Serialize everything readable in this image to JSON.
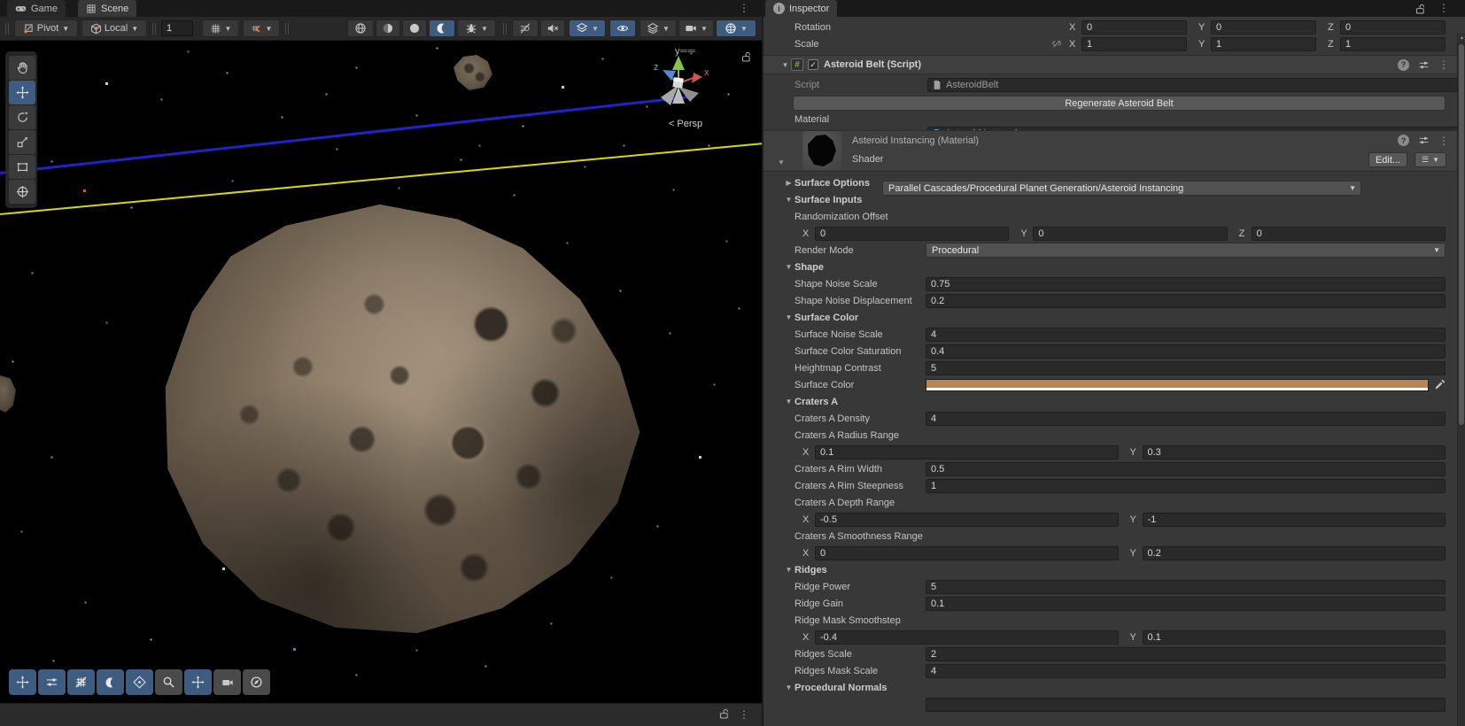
{
  "scene": {
    "tabs": [
      {
        "label": "Game"
      },
      {
        "label": "Scene"
      }
    ],
    "toolbar": {
      "pivot_label": "Pivot",
      "orientation_label": "Local",
      "grid_size": "1",
      "toggle_icons": [
        "wire-sphere-icon",
        "half-sphere-icon",
        "solid-sphere-icon",
        "crescent-icon",
        "bug-icon",
        "2d-off-icon",
        "speaker-muted-icon",
        "layers-paint-icon",
        "eye-icon",
        "layers-icon",
        "camera-icon",
        "gizmo-sphere-icon"
      ]
    },
    "overlays": {
      "tools": [
        "hand-tool",
        "move-tool",
        "rotate-tool",
        "scale-tool",
        "rect-tool",
        "transform-tool"
      ],
      "active_tool": "move-tool",
      "bottom_buttons": [
        "tools",
        "tool-settings",
        "grid-snap",
        "view-options",
        "gizmos",
        "search",
        "orientation",
        "camera-preview",
        "navigation"
      ]
    },
    "viewport": {
      "persp_label": "< Persp",
      "axis_x": "x",
      "axis_y": "y",
      "axis_z": "z"
    }
  },
  "inspector": {
    "tab_label": "Inspector",
    "transform": {
      "rotation_label": "Rotation",
      "rotation": {
        "x": "0",
        "y": "0",
        "z": "0"
      },
      "scale_label": "Scale",
      "scale": {
        "x": "1",
        "y": "1",
        "z": "1"
      },
      "axis_x": "X",
      "axis_y": "Y",
      "axis_z": "Z"
    },
    "component": {
      "title": "Asteroid Belt (Script)",
      "script_label": "Script",
      "script_value": "AsteroidBelt",
      "regenerate_button": "Regenerate Asteroid Belt",
      "material_label": "Material",
      "material_value": "Asteroid Instancing"
    },
    "material": {
      "title": "Asteroid Instancing (Material)",
      "shader_label": "Shader",
      "shader_value": "Parallel Cascades/Procedural Planet Generation/Asteroid Instancing",
      "edit_button": "Edit..."
    },
    "colors": {
      "surface_color": "#B98552",
      "accent_blue": "#3D5C80"
    },
    "rows": [
      {
        "type": "foldout",
        "label": "Surface Options",
        "open": false
      },
      {
        "type": "foldout",
        "label": "Surface Inputs",
        "open": true
      },
      {
        "type": "label",
        "label": "Randomization Offset"
      },
      {
        "type": "vec3",
        "x": "0",
        "y": "0",
        "z": "0"
      },
      {
        "type": "dropdown",
        "label": "Render Mode",
        "value": "Procedural"
      },
      {
        "type": "foldout",
        "label": "Shape",
        "open": true
      },
      {
        "type": "field",
        "label": "Shape Noise Scale",
        "value": "0.75"
      },
      {
        "type": "field",
        "label": "Shape Noise Displacement",
        "value": "0.2"
      },
      {
        "type": "foldout",
        "label": "Surface Color",
        "open": true
      },
      {
        "type": "field",
        "label": "Surface Noise Scale",
        "value": "4"
      },
      {
        "type": "field",
        "label": "Surface Color Saturation",
        "value": "0.4"
      },
      {
        "type": "field",
        "label": "Heightmap Contrast",
        "value": "5"
      },
      {
        "type": "color",
        "label": "Surface Color",
        "value": "#B98552"
      },
      {
        "type": "foldout",
        "label": "Craters A",
        "open": true
      },
      {
        "type": "field",
        "label": "Craters A Density",
        "value": "4"
      },
      {
        "type": "label",
        "label": "Craters A Radius Range"
      },
      {
        "type": "vec2",
        "x": "0.1",
        "y": "0.3"
      },
      {
        "type": "field",
        "label": "Craters A Rim Width",
        "value": "0.5"
      },
      {
        "type": "field",
        "label": "Craters A Rim Steepness",
        "value": "1"
      },
      {
        "type": "label",
        "label": "Craters A Depth Range"
      },
      {
        "type": "vec2",
        "x": "-0.5",
        "y": "-1"
      },
      {
        "type": "label",
        "label": "Craters A Smoothness Range"
      },
      {
        "type": "vec2",
        "x": "0",
        "y": "0.2"
      },
      {
        "type": "foldout",
        "label": "Ridges",
        "open": true
      },
      {
        "type": "field",
        "label": "Ridge Power",
        "value": "5"
      },
      {
        "type": "field",
        "label": "Ridge Gain",
        "value": "0.1"
      },
      {
        "type": "label",
        "label": "Ridge Mask Smoothstep"
      },
      {
        "type": "vec2",
        "x": "-0.4",
        "y": "0.1"
      },
      {
        "type": "field",
        "label": "Ridges Scale",
        "value": "2"
      },
      {
        "type": "field",
        "label": "Ridges Mask Scale",
        "value": "4"
      },
      {
        "type": "foldout",
        "label": "Procedural Normals",
        "open": true
      },
      {
        "type": "field",
        "label": "",
        "value": ""
      }
    ]
  }
}
